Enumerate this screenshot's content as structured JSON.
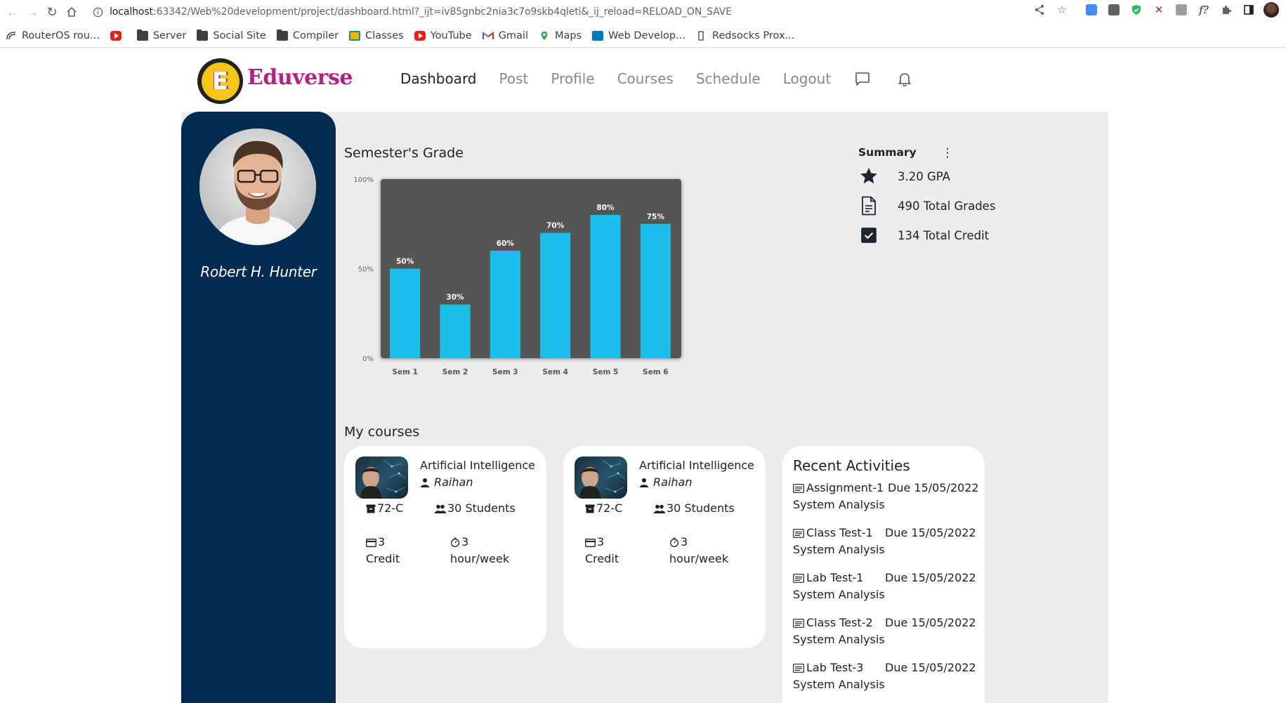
{
  "browser": {
    "url_host": "localhost",
    "url_rest": ":63342/Web%20development/project/dashboard.html?_ijt=iv85gnbc2nia3c7o9skb4qleti&_ij_reload=RELOAD_ON_SAVE",
    "bookmarks": [
      {
        "label": "RouterOS rou...",
        "icon": "routeros-icon"
      },
      {
        "label": "",
        "icon": "youtube-icon"
      },
      {
        "label": "Server",
        "icon": "folder-icon"
      },
      {
        "label": "Social Site",
        "icon": "folder-icon"
      },
      {
        "label": "Compiler",
        "icon": "folder-icon"
      },
      {
        "label": "Classes",
        "icon": "classroom-icon"
      },
      {
        "label": "YouTube",
        "icon": "youtube-icon"
      },
      {
        "label": "Gmail",
        "icon": "gmail-icon"
      },
      {
        "label": "Maps",
        "icon": "maps-icon"
      },
      {
        "label": "Web Develop...",
        "icon": "trello-icon"
      },
      {
        "label": "Redsocks Prox...",
        "icon": "page-icon"
      }
    ]
  },
  "app": {
    "brand": "Eduverse",
    "logo_letter": "E",
    "nav": [
      "Dashboard",
      "Post",
      "Profile",
      "Courses",
      "Schedule",
      "Logout"
    ],
    "active_nav": "Dashboard"
  },
  "user": {
    "name": "Robert H. Hunter"
  },
  "grades": {
    "title": "Semester's Grade"
  },
  "chart_data": {
    "type": "bar",
    "categories": [
      "Sem 1",
      "Sem 2",
      "Sem 3",
      "Sem 4",
      "Sem 5",
      "Sem 6"
    ],
    "values": [
      50,
      30,
      60,
      70,
      80,
      75
    ],
    "data_labels": [
      "50%",
      "30%",
      "60%",
      "70%",
      "80%",
      "75%"
    ],
    "yticks": [
      "0%",
      "50%",
      "100%"
    ],
    "ylim": [
      0,
      100
    ],
    "bar_color": "#1bbfe9",
    "plot_bg": "#555555",
    "grid": false
  },
  "summary": {
    "title": "Summary",
    "items": [
      {
        "icon": "star-icon",
        "text": "3.20 GPA"
      },
      {
        "icon": "document-icon",
        "text": "490 Total Grades"
      },
      {
        "icon": "checkbox-icon",
        "text": "134 Total Credit"
      }
    ]
  },
  "courses": {
    "title": "My courses",
    "items": [
      {
        "name": "Artificial Intelligence",
        "instructor": "Raihan",
        "room": "72-C",
        "students": "30 Students",
        "credit_value": "3",
        "credit_label": "Credit",
        "hours_value": "3",
        "hours_label": "hour/week"
      },
      {
        "name": "Artificial Intelligence",
        "instructor": "Raihan",
        "room": "72-C",
        "students": "30 Students",
        "credit_value": "3",
        "credit_label": "Credit",
        "hours_value": "3",
        "hours_label": "hour/week"
      }
    ]
  },
  "activities": {
    "title": "Recent Activities",
    "items": [
      {
        "name": "Assignment-1",
        "due": "Due 15/05/2022",
        "course": "System Analysis"
      },
      {
        "name": "Class Test-1",
        "due": "Due 15/05/2022",
        "course": "System Analysis"
      },
      {
        "name": "Lab Test-1",
        "due": "Due 15/05/2022",
        "course": "System Analysis"
      },
      {
        "name": "Class Test-2",
        "due": "Due 15/05/2022",
        "course": "System Analysis"
      },
      {
        "name": "Lab Test-3",
        "due": "Due 15/05/2022",
        "course": "System Analysis"
      }
    ]
  }
}
